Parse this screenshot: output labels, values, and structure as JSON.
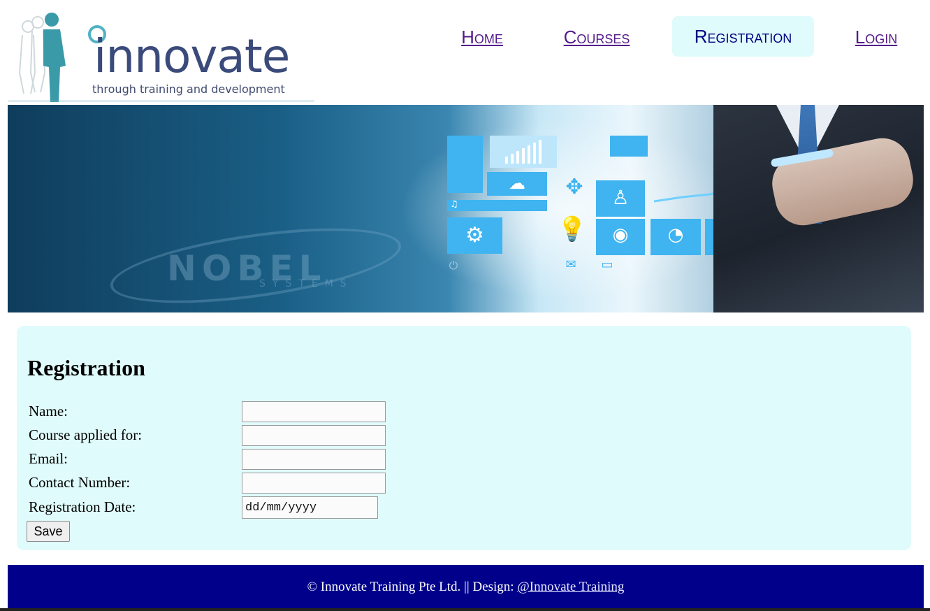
{
  "logo": {
    "word": "innovate",
    "tagline": "through training and development"
  },
  "nav": {
    "items": [
      {
        "label": "Home"
      },
      {
        "label": "Courses"
      },
      {
        "label": "Registration"
      },
      {
        "label": "Login"
      }
    ],
    "current": "Registration"
  },
  "banner": {
    "watermark": "NOBEL",
    "watermark_sub": "SYSTEMS"
  },
  "form": {
    "title": "Registration",
    "fields": [
      {
        "label": "Name:",
        "value": ""
      },
      {
        "label": "Course applied for:",
        "value": ""
      },
      {
        "label": "Email:",
        "value": ""
      },
      {
        "label": "Contact Number:",
        "value": ""
      },
      {
        "label": "Registration Date:",
        "value": "dd/mm/yyyy"
      }
    ],
    "save_label": "Save"
  },
  "footer": {
    "text": "© Innovate Training Pte Ltd. || Design: ",
    "link": "@Innovate Training"
  },
  "colors": {
    "nav_link": "#551a8b",
    "nav_current_bg": "#e0fbfb",
    "content_bg": "#e0fbfb",
    "footer_bg": "#00008b"
  }
}
